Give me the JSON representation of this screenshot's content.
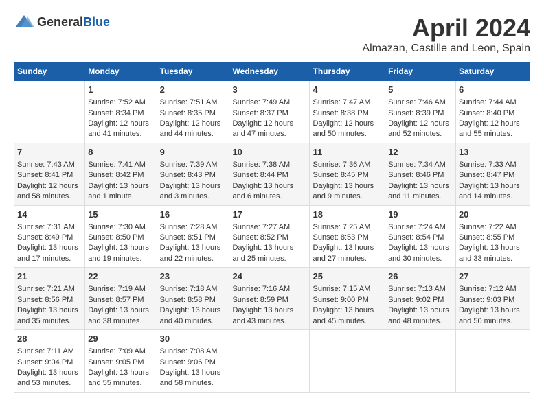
{
  "header": {
    "logo_general": "General",
    "logo_blue": "Blue",
    "title": "April 2024",
    "subtitle": "Almazan, Castille and Leon, Spain"
  },
  "days_of_week": [
    "Sunday",
    "Monday",
    "Tuesday",
    "Wednesday",
    "Thursday",
    "Friday",
    "Saturday"
  ],
  "weeks": [
    [
      {
        "day": "",
        "content": ""
      },
      {
        "day": "1",
        "content": "Sunrise: 7:52 AM\nSunset: 8:34 PM\nDaylight: 12 hours and 41 minutes."
      },
      {
        "day": "2",
        "content": "Sunrise: 7:51 AM\nSunset: 8:35 PM\nDaylight: 12 hours and 44 minutes."
      },
      {
        "day": "3",
        "content": "Sunrise: 7:49 AM\nSunset: 8:37 PM\nDaylight: 12 hours and 47 minutes."
      },
      {
        "day": "4",
        "content": "Sunrise: 7:47 AM\nSunset: 8:38 PM\nDaylight: 12 hours and 50 minutes."
      },
      {
        "day": "5",
        "content": "Sunrise: 7:46 AM\nSunset: 8:39 PM\nDaylight: 12 hours and 52 minutes."
      },
      {
        "day": "6",
        "content": "Sunrise: 7:44 AM\nSunset: 8:40 PM\nDaylight: 12 hours and 55 minutes."
      }
    ],
    [
      {
        "day": "7",
        "content": "Sunrise: 7:43 AM\nSunset: 8:41 PM\nDaylight: 12 hours and 58 minutes."
      },
      {
        "day": "8",
        "content": "Sunrise: 7:41 AM\nSunset: 8:42 PM\nDaylight: 13 hours and 1 minute."
      },
      {
        "day": "9",
        "content": "Sunrise: 7:39 AM\nSunset: 8:43 PM\nDaylight: 13 hours and 3 minutes."
      },
      {
        "day": "10",
        "content": "Sunrise: 7:38 AM\nSunset: 8:44 PM\nDaylight: 13 hours and 6 minutes."
      },
      {
        "day": "11",
        "content": "Sunrise: 7:36 AM\nSunset: 8:45 PM\nDaylight: 13 hours and 9 minutes."
      },
      {
        "day": "12",
        "content": "Sunrise: 7:34 AM\nSunset: 8:46 PM\nDaylight: 13 hours and 11 minutes."
      },
      {
        "day": "13",
        "content": "Sunrise: 7:33 AM\nSunset: 8:47 PM\nDaylight: 13 hours and 14 minutes."
      }
    ],
    [
      {
        "day": "14",
        "content": "Sunrise: 7:31 AM\nSunset: 8:49 PM\nDaylight: 13 hours and 17 minutes."
      },
      {
        "day": "15",
        "content": "Sunrise: 7:30 AM\nSunset: 8:50 PM\nDaylight: 13 hours and 19 minutes."
      },
      {
        "day": "16",
        "content": "Sunrise: 7:28 AM\nSunset: 8:51 PM\nDaylight: 13 hours and 22 minutes."
      },
      {
        "day": "17",
        "content": "Sunrise: 7:27 AM\nSunset: 8:52 PM\nDaylight: 13 hours and 25 minutes."
      },
      {
        "day": "18",
        "content": "Sunrise: 7:25 AM\nSunset: 8:53 PM\nDaylight: 13 hours and 27 minutes."
      },
      {
        "day": "19",
        "content": "Sunrise: 7:24 AM\nSunset: 8:54 PM\nDaylight: 13 hours and 30 minutes."
      },
      {
        "day": "20",
        "content": "Sunrise: 7:22 AM\nSunset: 8:55 PM\nDaylight: 13 hours and 33 minutes."
      }
    ],
    [
      {
        "day": "21",
        "content": "Sunrise: 7:21 AM\nSunset: 8:56 PM\nDaylight: 13 hours and 35 minutes."
      },
      {
        "day": "22",
        "content": "Sunrise: 7:19 AM\nSunset: 8:57 PM\nDaylight: 13 hours and 38 minutes."
      },
      {
        "day": "23",
        "content": "Sunrise: 7:18 AM\nSunset: 8:58 PM\nDaylight: 13 hours and 40 minutes."
      },
      {
        "day": "24",
        "content": "Sunrise: 7:16 AM\nSunset: 8:59 PM\nDaylight: 13 hours and 43 minutes."
      },
      {
        "day": "25",
        "content": "Sunrise: 7:15 AM\nSunset: 9:00 PM\nDaylight: 13 hours and 45 minutes."
      },
      {
        "day": "26",
        "content": "Sunrise: 7:13 AM\nSunset: 9:02 PM\nDaylight: 13 hours and 48 minutes."
      },
      {
        "day": "27",
        "content": "Sunrise: 7:12 AM\nSunset: 9:03 PM\nDaylight: 13 hours and 50 minutes."
      }
    ],
    [
      {
        "day": "28",
        "content": "Sunrise: 7:11 AM\nSunset: 9:04 PM\nDaylight: 13 hours and 53 minutes."
      },
      {
        "day": "29",
        "content": "Sunrise: 7:09 AM\nSunset: 9:05 PM\nDaylight: 13 hours and 55 minutes."
      },
      {
        "day": "30",
        "content": "Sunrise: 7:08 AM\nSunset: 9:06 PM\nDaylight: 13 hours and 58 minutes."
      },
      {
        "day": "",
        "content": ""
      },
      {
        "day": "",
        "content": ""
      },
      {
        "day": "",
        "content": ""
      },
      {
        "day": "",
        "content": ""
      }
    ]
  ]
}
